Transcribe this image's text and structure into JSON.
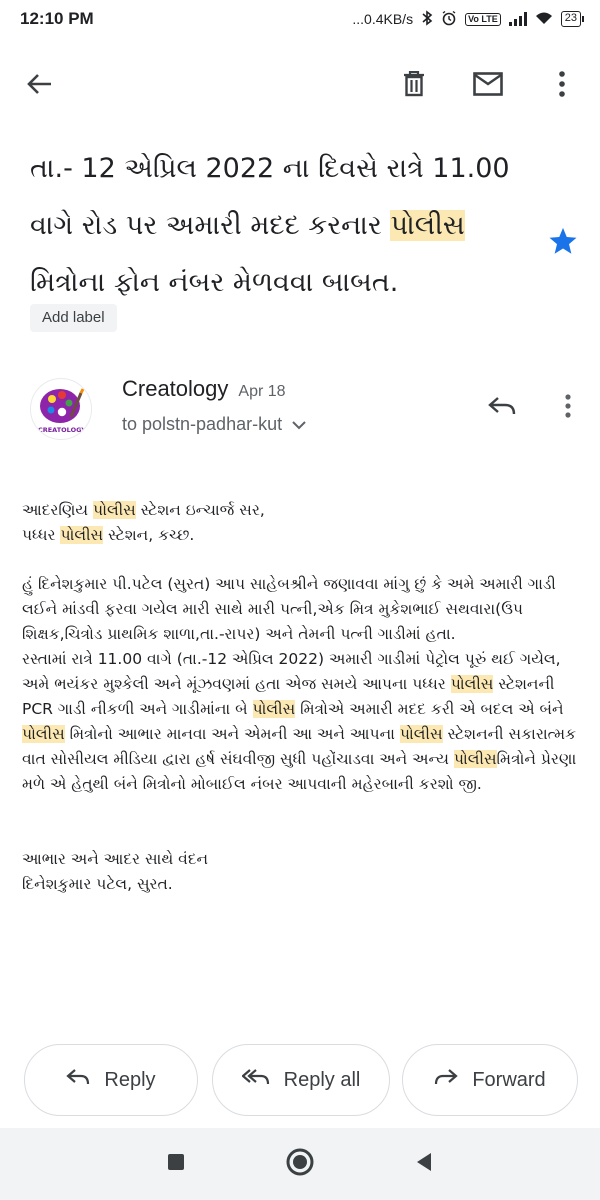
{
  "status_bar": {
    "time": "12:10 PM",
    "network_speed": "...0.4KB/s",
    "battery": "23",
    "volte": "Vo LTE"
  },
  "toolbar": {
    "icons": [
      "back-arrow-icon",
      "delete-icon",
      "mail-icon",
      "more-vert-icon"
    ]
  },
  "email": {
    "subject_before": "તા.- 12 એપ્રિલ 2022 ના દિવસે રાત્રે 11.00 વાગે રોડ પર અમારી મદદ કરનાર ",
    "subject_highlight": "પોલીસ",
    "subject_after": " મિત્રોના ફોન નંબર મેળવવા બાબત.",
    "starred": true,
    "star_color": "#1a73e8",
    "add_label": "Add label",
    "sender_name": "Creatology",
    "sender_logo_text": "CREATOLOGY",
    "date": "Apr 18",
    "recipient": "to polstn-padhar-kut",
    "body": {
      "greeting_l1_before": "આદરણિય ",
      "greeting_l1_highlight": "પોલીસ",
      "greeting_l1_after": " સ્ટેશન ઇન્ચાર્જ સર,",
      "greeting_l2_before": "પધ્ધર ",
      "greeting_l2_highlight": "પોલીસ",
      "greeting_l2_after": " સ્ટેશન, કચ્છ.",
      "p1": "હું દિનેશકુમાર પી.પટેલ (સુરત) આપ સાહેબશ્રીને જણાવવા માંગુ છું કે અમે અમારી ગાડી લઈને માંડવી ફરવા ગયેલ મારી સાથે મારી પત્ની,એક મિત્ર મુકેશભાઈ સથવારા(ઉપ શિક્ષક,ચિત્રોડ પ્રાથમિક શાળા,તા.-રાપર) અને તેમની પત્ની ગાડીમાં હતા.",
      "p2_s1": "રસ્તામાં રાત્રે 11.00 વાગે (તા.-12 એપ્રિલ 2022) અમારી ગાડીમાં પેટ્રોલ પૂરું થઈ ગયેલ, અમે ભયંકર મુશ્કેલી અને મૂંઝવણમાં હતા એજ સમયે આપના પધ્ધર ",
      "p2_h1": "પોલીસ",
      "p2_s2": " સ્ટેશનની PCR ગાડી નીકળી અને ગાડીમાંના બે ",
      "p2_h2": "પોલીસ",
      "p2_s3": " મિત્રોએ અમારી મદદ કરી એ બદલ એ બંને ",
      "p2_h3": "પોલીસ",
      "p2_s4": " મિત્રોનો આભાર માનવા અને એમની આ અને આપના ",
      "p2_h4": "પોલીસ",
      "p2_s5": " સ્ટેશનની સકારાત્મક વાત સોસીયલ મીડિયા દ્વારા હર્ષ સંઘવીજી સુધી પહોંચાડવા અને અન્ય ",
      "p2_h5": "પોલીસ",
      "p2_s6": "મિત્રોને પ્રેરણા મળે એ હેતુથી બંને મિત્રોનો મોબાઈલ નંબર આપવાની મહેરબાની કરશો જી.",
      "closing_l1": "આભાર અને આદર સાથે વંદન",
      "closing_l2": "દિનેશકુમાર પટેલ, સુરત."
    }
  },
  "actions": {
    "reply": "Reply",
    "reply_all": "Reply all",
    "forward": "Forward"
  },
  "colors": {
    "highlight": "#fce8b2",
    "text": "#202124",
    "secondary_text": "#5f6368"
  }
}
